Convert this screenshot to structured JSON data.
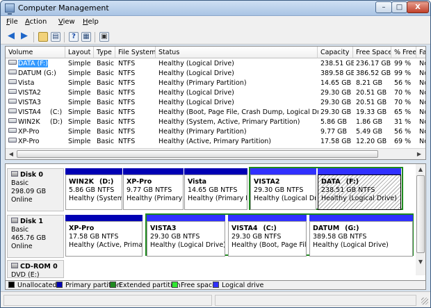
{
  "window": {
    "title": "Computer Management",
    "minimize": "–",
    "maximize": "□",
    "close": "X"
  },
  "menu": [
    {
      "label": "File",
      "underline": "F",
      "rest": "ile"
    },
    {
      "label": "Action",
      "underline": "A",
      "rest": "ction"
    },
    {
      "label": "View",
      "underline": "V",
      "rest": "iew"
    },
    {
      "label": "Help",
      "underline": "H",
      "rest": "elp"
    }
  ],
  "toolbar": [
    "back-arrow-icon",
    "forward-arrow-icon",
    "up-folder-icon",
    "console-tree-icon",
    "help-icon",
    "properties-icon",
    "export-icon"
  ],
  "volume_list": {
    "columns": [
      "Volume",
      "Layout",
      "Type",
      "File System",
      "Status",
      "Capacity",
      "Free Space",
      "% Free",
      "Fa"
    ],
    "rows": [
      {
        "volume": "DATA (F:)",
        "letter": "",
        "layout": "Simple",
        "type": "Basic",
        "fs": "NTFS",
        "status": "Healthy (Logical Drive)",
        "capacity": "238.51 GB",
        "free": "236.17 GB",
        "pct": "99 %",
        "fa": "No",
        "selected": true
      },
      {
        "volume": "DATUM (G:)",
        "letter": "",
        "layout": "Simple",
        "type": "Basic",
        "fs": "NTFS",
        "status": "Healthy (Logical Drive)",
        "capacity": "389.58 GB",
        "free": "386.52 GB",
        "pct": "99 %",
        "fa": "No"
      },
      {
        "volume": "Vista",
        "letter": "",
        "layout": "Simple",
        "type": "Basic",
        "fs": "NTFS",
        "status": "Healthy (Primary Partition)",
        "capacity": "14.65 GB",
        "free": "8.21 GB",
        "pct": "56 %",
        "fa": "No"
      },
      {
        "volume": "VISTA2",
        "letter": "",
        "layout": "Simple",
        "type": "Basic",
        "fs": "NTFS",
        "status": "Healthy (Logical Drive)",
        "capacity": "29.30 GB",
        "free": "20.51 GB",
        "pct": "70 %",
        "fa": "No"
      },
      {
        "volume": "VISTA3",
        "letter": "",
        "layout": "Simple",
        "type": "Basic",
        "fs": "NTFS",
        "status": "Healthy (Logical Drive)",
        "capacity": "29.30 GB",
        "free": "20.51 GB",
        "pct": "70 %",
        "fa": "No"
      },
      {
        "volume": "VISTA4",
        "letter": "(C:)",
        "layout": "Simple",
        "type": "Basic",
        "fs": "NTFS",
        "status": "Healthy (Boot, Page File, Crash Dump, Logical Drive)",
        "capacity": "29.30 GB",
        "free": "19.33 GB",
        "pct": "65 %",
        "fa": "No"
      },
      {
        "volume": "WIN2K",
        "letter": "(D:)",
        "layout": "Simple",
        "type": "Basic",
        "fs": "NTFS",
        "status": "Healthy (System, Active, Primary Partition)",
        "capacity": "5.86 GB",
        "free": "1.86 GB",
        "pct": "31 %",
        "fa": "No"
      },
      {
        "volume": "XP-Pro",
        "letter": "",
        "layout": "Simple",
        "type": "Basic",
        "fs": "NTFS",
        "status": "Healthy (Primary Partition)",
        "capacity": "9.77 GB",
        "free": "5.49 GB",
        "pct": "56 %",
        "fa": "No"
      },
      {
        "volume": "XP-Pro",
        "letter": "",
        "layout": "Simple",
        "type": "Basic",
        "fs": "NTFS",
        "status": "Healthy (Active, Primary Partition)",
        "capacity": "17.58 GB",
        "free": "12.20 GB",
        "pct": "69 %",
        "fa": "No"
      }
    ]
  },
  "disks": [
    {
      "name": "Disk 0",
      "type": "Basic",
      "size": "298.09 GB",
      "state": "Online",
      "partitions": [
        {
          "name": "WIN2K",
          "letter": "(D:)",
          "size": "5.86 GB NTFS",
          "status": "Healthy (System,",
          "kind": "primary"
        },
        {
          "name": "XP-Pro",
          "letter": "",
          "size": "9.77 GB NTFS",
          "status": "Healthy (Primary",
          "kind": "primary"
        },
        {
          "name": "Vista",
          "letter": "",
          "size": "14.65 GB NTFS",
          "status": "Healthy (Primary P",
          "kind": "primary"
        },
        {
          "name": "VISTA2",
          "letter": "",
          "size": "29.30 GB NTFS",
          "status": "Healthy (Logical Dr",
          "kind": "logical"
        },
        {
          "name": "DATA",
          "letter": "(F:)",
          "size": "238.51 GB NTFS",
          "status": "Healthy (Logical Drive)",
          "kind": "logical",
          "selected": true
        }
      ]
    },
    {
      "name": "Disk 1",
      "type": "Basic",
      "size": "465.76 GB",
      "state": "Online",
      "partitions": [
        {
          "name": "XP-Pro",
          "letter": "",
          "size": "17.58 GB NTFS",
          "status": "Healthy (Active, Primar",
          "kind": "primary"
        },
        {
          "name": "VISTA3",
          "letter": "",
          "size": "29.30 GB NTFS",
          "status": "Healthy (Logical Drive)",
          "kind": "logical"
        },
        {
          "name": "VISTA4",
          "letter": "(C:)",
          "size": "29.30 GB NTFS",
          "status": "Healthy (Boot, Page File,",
          "kind": "logical"
        },
        {
          "name": "DATUM",
          "letter": "(G:)",
          "size": "389.58 GB NTFS",
          "status": "Healthy (Logical Drive)",
          "kind": "logical"
        }
      ]
    },
    {
      "name": "CD-ROM 0",
      "type": "DVD (E:)",
      "size": "",
      "state": "",
      "partitions": []
    }
  ],
  "legend": [
    {
      "label": "Unallocated",
      "color": "#000000"
    },
    {
      "label": "Primary partition",
      "color": "#0000b4"
    },
    {
      "label": "Extended partition",
      "color": "#1e8a1e"
    },
    {
      "label": "Free space",
      "color": "#30e830"
    },
    {
      "label": "Logical drive",
      "color": "#3030ff"
    }
  ]
}
